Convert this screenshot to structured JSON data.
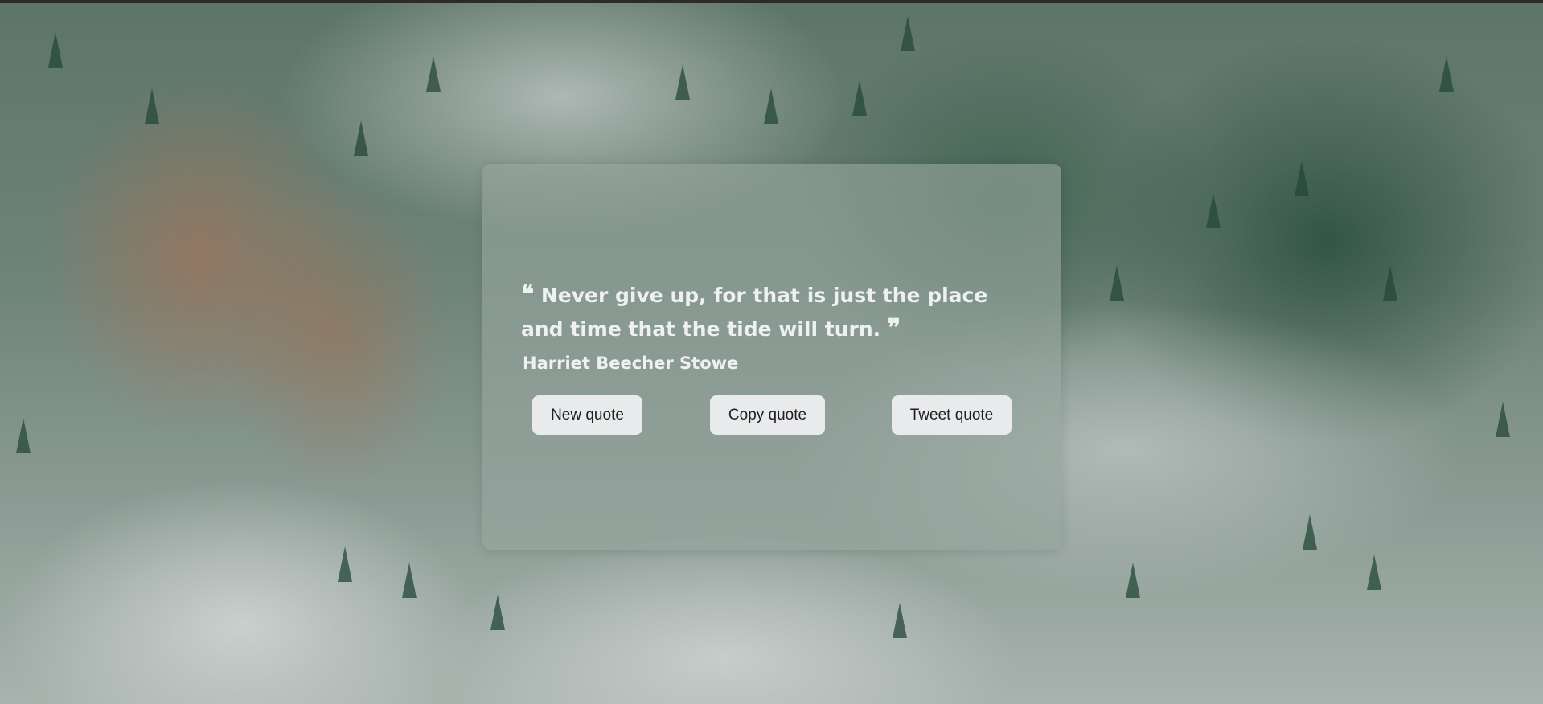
{
  "quote": {
    "open_mark": "❝",
    "text": "Never give up, for that is just the place and time that the tide will turn.",
    "close_mark": "❞",
    "author": "Harriet Beecher Stowe"
  },
  "buttons": {
    "new_label": "New quote",
    "copy_label": "Copy quote",
    "tweet_label": "Tweet quote"
  },
  "background": {
    "image": "misty-forest",
    "mist_color": "#cfd5d4",
    "forest_color": "#2f5a46",
    "autumn_color": "#b06e4e"
  }
}
